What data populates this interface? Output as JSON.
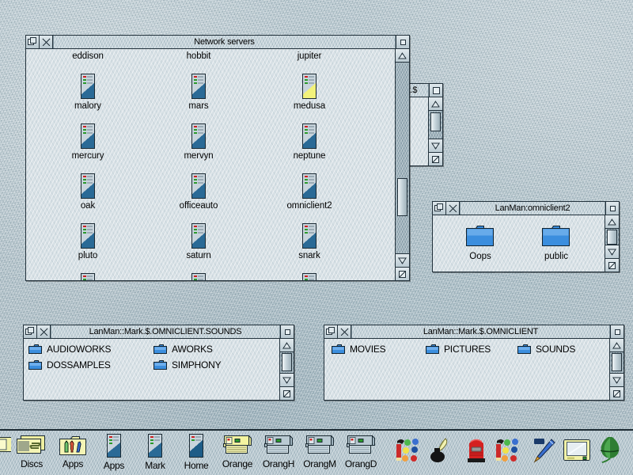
{
  "desktop": {
    "os": "RISC OS Desktop",
    "background_color": "#b4c4cc"
  },
  "windows": {
    "network_servers": {
      "title": "Network servers",
      "icon_type": "server-icon",
      "items": [
        {
          "label": "eddison",
          "state": "normal"
        },
        {
          "label": "hobbit",
          "state": "normal"
        },
        {
          "label": "jupiter",
          "state": "normal"
        },
        {
          "label": "malory",
          "state": "normal"
        },
        {
          "label": "mars",
          "state": "normal"
        },
        {
          "label": "medusa",
          "state": "highlight"
        },
        {
          "label": "mercury",
          "state": "normal"
        },
        {
          "label": "mervyn",
          "state": "normal"
        },
        {
          "label": "neptune",
          "state": "normal"
        },
        {
          "label": "oak",
          "state": "normal"
        },
        {
          "label": "officeauto",
          "state": "normal"
        },
        {
          "label": "omniclient2",
          "state": "normal"
        },
        {
          "label": "pluto",
          "state": "normal"
        },
        {
          "label": "saturn",
          "state": "normal"
        },
        {
          "label": "snark",
          "state": "normal"
        }
      ],
      "scroll_position": "near-bottom"
    },
    "obscured": {
      "title_fragment": "t.$"
    },
    "omniclient2": {
      "title": "LanMan:omniclient2",
      "items": [
        {
          "label": "Oops"
        },
        {
          "label": "public"
        }
      ]
    },
    "sounds": {
      "title": "LanMan::Mark.$.OMNICLIENT.SOUNDS",
      "items": [
        {
          "label": "AUDIOWORKS"
        },
        {
          "label": "AWORKS"
        },
        {
          "label": "DOSSAMPLES"
        },
        {
          "label": "SIMPHONY"
        }
      ]
    },
    "omniclient": {
      "title": "LanMan::Mark.$.OMNICLIENT",
      "items": [
        {
          "label": "MOVIES"
        },
        {
          "label": "PICTURES"
        },
        {
          "label": "SOUNDS"
        }
      ]
    }
  },
  "iconbar": {
    "left": [
      {
        "label": "",
        "icon": "disc-icon",
        "state": "clipped"
      },
      {
        "label": "Discs",
        "icon": "disc-icon",
        "state": "active"
      },
      {
        "label": "Apps",
        "icon": "apps-folder-icon",
        "state": "active"
      },
      {
        "label": "Apps",
        "icon": "server-icon",
        "state": "normal"
      },
      {
        "label": "Mark",
        "icon": "server-icon",
        "state": "normal"
      },
      {
        "label": "Home",
        "icon": "server-icon",
        "state": "normal"
      },
      {
        "label": "Orange",
        "icon": "printer-icon",
        "state": "active"
      },
      {
        "label": "OrangH",
        "icon": "printer-icon",
        "state": "normal"
      },
      {
        "label": "OrangM",
        "icon": "printer-icon",
        "state": "normal"
      },
      {
        "label": "OrangD",
        "icon": "printer-icon",
        "state": "normal"
      }
    ],
    "right": [
      {
        "label": "",
        "icon": "paint-palette-icon"
      },
      {
        "label": "",
        "icon": "quill-inkwell-icon"
      },
      {
        "label": "",
        "icon": "postbox-icon"
      },
      {
        "label": "",
        "icon": "paint-palette-icon"
      },
      {
        "label": "",
        "icon": "fountain-pen-icon"
      },
      {
        "label": "",
        "icon": "monitor-icon"
      },
      {
        "label": "",
        "icon": "acorn-leaf-icon"
      }
    ]
  },
  "colors": {
    "window_face": "#d3dde2",
    "title_face": "#c3d1d8",
    "border": "#23323c",
    "folder_blue": "#3b8ede",
    "server_blue": "#2a6a96",
    "server_highlight": "#f2f27a",
    "icon_yellow": "#f4f4a0"
  }
}
